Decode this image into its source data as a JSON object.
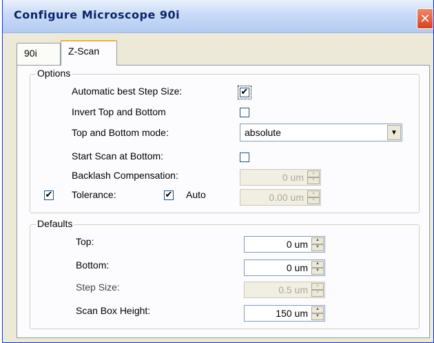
{
  "window": {
    "title": "Configure Microscope 90i",
    "close_glyph": "✕"
  },
  "tabs": [
    {
      "label": "90i",
      "active": false
    },
    {
      "label": "Z-Scan",
      "active": true
    }
  ],
  "options": {
    "legend": "Options",
    "auto_step": {
      "label": "Automatic best Step Size:",
      "checked": true
    },
    "invert": {
      "label": "Invert Top and Bottom",
      "checked": false
    },
    "mode": {
      "label": "Top and Bottom mode:",
      "value": "absolute"
    },
    "start_bottom": {
      "label": "Start Scan at Bottom:",
      "checked": false
    },
    "backlash": {
      "label": "Backlash Compensation:",
      "value": "0 um"
    },
    "tolerance": {
      "label": "Tolerance:",
      "checked": true,
      "auto_label": "Auto",
      "auto_checked": true,
      "value": "0.00 um"
    }
  },
  "defaults": {
    "legend": "Defaults",
    "top": {
      "label": "Top:",
      "value": "0 um"
    },
    "bottom": {
      "label": "Bottom:",
      "value": "0 um"
    },
    "step": {
      "label": "Step Size:",
      "value": "0.5 um"
    },
    "scan_box": {
      "label": "Scan Box Height:",
      "value": "150 um"
    }
  },
  "glyphs": {
    "check": "✔",
    "arrow_down": "▼",
    "spin_up": "▲",
    "spin_down": "▼"
  },
  "colors": {
    "accent": "#0a246a",
    "tab_highlight": "#f2b133",
    "close": "#d9401f"
  }
}
